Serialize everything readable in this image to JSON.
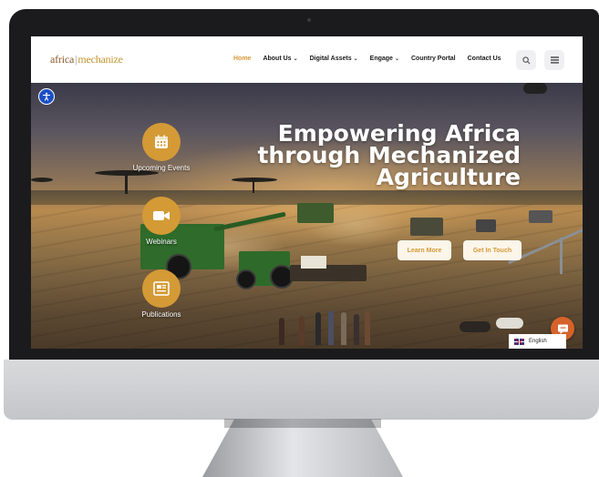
{
  "nav": {
    "logo_primary": "africa",
    "logo_separator": "|",
    "logo_secondary": "mechanize",
    "menu": [
      {
        "label": "Home",
        "active": true,
        "dropdown": false
      },
      {
        "label": "About Us",
        "active": false,
        "dropdown": true
      },
      {
        "label": "Digital Assets",
        "active": false,
        "dropdown": true
      },
      {
        "label": "Engage",
        "active": false,
        "dropdown": true
      },
      {
        "label": "Country Portal",
        "active": false,
        "dropdown": false
      },
      {
        "label": "Contact Us",
        "active": false,
        "dropdown": false
      }
    ],
    "search_icon": "search-icon",
    "menu_icon": "hamburger-icon"
  },
  "hero": {
    "headline_line1": "Empowering Africa",
    "headline_line2": "through Mechanized",
    "headline_line3": "Agriculture",
    "cta_primary": "Learn More",
    "cta_secondary": "Get In Touch"
  },
  "side_links": [
    {
      "label": "Upcoming Events",
      "icon": "calendar-icon"
    },
    {
      "label": "Webinars",
      "icon": "video-camera-icon"
    },
    {
      "label": "Publications",
      "icon": "newspaper-icon"
    }
  ],
  "language": {
    "selected": "English",
    "flag": "uk-flag-icon"
  },
  "accessibility_icon": "accessibility-icon",
  "chat_icon": "chat-icon",
  "colors": {
    "accent": "#d49a36",
    "nav_active": "#d89a35",
    "chat": "#d6632b",
    "a11y": "#1b4fc4"
  }
}
